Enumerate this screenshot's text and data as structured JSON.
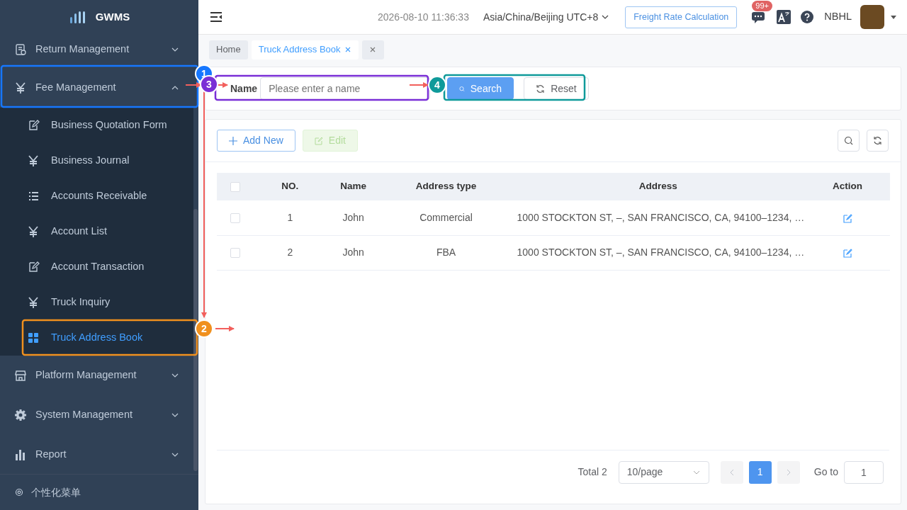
{
  "sidebar": {
    "logo_text": "GWMS",
    "items": [
      {
        "label": "Return Management",
        "expanded": false
      },
      {
        "label": "Fee Management",
        "expanded": true,
        "children": [
          {
            "label": "Business Quotation Form",
            "selected": false
          },
          {
            "label": "Business Journal",
            "selected": false
          },
          {
            "label": "Accounts Receivable",
            "selected": false
          },
          {
            "label": "Account List",
            "selected": false
          },
          {
            "label": "Account Transaction",
            "selected": false
          },
          {
            "label": "Truck Inquiry",
            "selected": false
          },
          {
            "label": "Truck Address Book",
            "selected": true
          }
        ]
      },
      {
        "label": "Platform Management",
        "expanded": false
      },
      {
        "label": "System Management",
        "expanded": false
      },
      {
        "label": "Report",
        "expanded": false
      }
    ],
    "footer": "个性化菜单"
  },
  "header": {
    "datetime": "2026-08-10 11:36:33",
    "timezone": "Asia/China/Beijing UTC+8",
    "action_button": "Freight Rate Calculation",
    "message_badge": "99+",
    "user": "NBHL"
  },
  "tags": [
    {
      "label": "Home",
      "selected": false,
      "closable": false
    },
    {
      "label": "Truck Address Book",
      "selected": true,
      "closable": true
    }
  ],
  "search_form": {
    "label": "Name",
    "placeholder": "Please enter a name",
    "buttons": [
      "Search",
      "Reset"
    ]
  },
  "toolbar": [
    {
      "label": "Add New",
      "disabled": false
    },
    {
      "label": "Edit",
      "disabled": true
    }
  ],
  "table": {
    "all_checked": false,
    "columns": [
      "NO.",
      "Name",
      "Address type",
      "Address",
      "Action"
    ],
    "rows": [
      {
        "checked": false,
        "cells": [
          "1",
          "John",
          "Commercial",
          "1000 STOCKTON ST, –, SAN FRANCISCO, CA, 94100–1234, …"
        ]
      },
      {
        "checked": false,
        "cells": [
          "2",
          "John",
          "FBA",
          "1000 STOCKTON ST, –, SAN FRANCISCO, CA, 94100–1234, …"
        ]
      }
    ]
  },
  "pagination": {
    "total": "Total 2",
    "page_size": "10/page",
    "pages": [
      {
        "label": "1",
        "selected": true
      }
    ],
    "goto_label": "Go to",
    "goto_value": "1"
  },
  "annotations": [
    {
      "number": "1",
      "color": "#1677ff"
    },
    {
      "number": "3",
      "color": "#7a2fd6"
    },
    {
      "number": "4",
      "color": "#0f9a9a"
    },
    {
      "number": "2",
      "color": "#f0901e"
    }
  ]
}
